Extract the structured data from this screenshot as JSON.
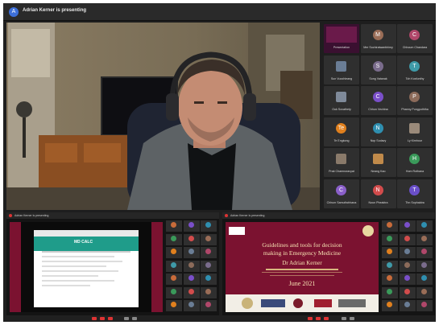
{
  "header": {
    "avatar_letter": "A",
    "presenting_label": "Adrian Kerner is presenting"
  },
  "participants": [
    {
      "kind": "presentation",
      "name": "Presentation",
      "color": "#6a1a4a"
    },
    {
      "kind": "letter",
      "letter": "M",
      "name": "Mer Sochiratwanbhimy",
      "color": "#9a6d57"
    },
    {
      "kind": "letter",
      "letter": "C",
      "name": "Chhoum Chandara",
      "color": "#b0476a"
    },
    {
      "kind": "photo",
      "name": "Sun Vuochleang",
      "color": "#6a7d95"
    },
    {
      "kind": "letter",
      "letter": "S",
      "name": "Song Vatanak",
      "color": "#7a6c8c"
    },
    {
      "kind": "letter",
      "letter": "T",
      "name": "Toh Kosfunthy",
      "color": "#3f9aa8"
    },
    {
      "kind": "photo",
      "name": "Ouk Sovathety",
      "color": "#7f8a9a"
    },
    {
      "kind": "letter",
      "letter": "C",
      "name": "Chhun Vechina",
      "color": "#7a4fc9"
    },
    {
      "kind": "letter",
      "letter": "P",
      "name": "Phanny Pungpuththa",
      "color": "#8c6b5a"
    },
    {
      "kind": "letter",
      "letter": "Te",
      "name": "Te Engkong",
      "color": "#e0801e"
    },
    {
      "kind": "letter",
      "letter": "N",
      "name": "Nop Sodavy",
      "color": "#2f8fb0"
    },
    {
      "kind": "photo",
      "name": "Ly Kimhour",
      "color": "#9a8a7a"
    },
    {
      "kind": "photo",
      "name": "Prak Chamnoravyat",
      "color": "#8a7a6a"
    },
    {
      "kind": "photo",
      "name": "Neang Kao",
      "color": "#c08a4a"
    },
    {
      "kind": "letter",
      "letter": "H",
      "name": "Hom Rothana",
      "color": "#3a9a5a"
    },
    {
      "kind": "letter",
      "letter": "C",
      "name": "Chhum Samuthchhana",
      "color": "#8a5fc9"
    },
    {
      "kind": "letter",
      "letter": "N",
      "name": "Noun Pheaktra",
      "color": "#d24c4c"
    },
    {
      "kind": "letter",
      "letter": "T",
      "name": "Thn Sophaktra",
      "color": "#6a4fc9"
    }
  ],
  "bottom_left": {
    "bar_label": "Adrian Kerner is presenting",
    "browser_title": "MD CALC"
  },
  "bottom_right": {
    "bar_label": "Adrian Kerner is presenting",
    "slide": {
      "line1": "Guidelines and tools for decision",
      "line2": "making in Emergency Medicine",
      "presenter": "Dr Adrian Kerner",
      "date": "June 2021"
    }
  },
  "mini_colors": [
    "#c86b3a",
    "#7a4fc9",
    "#2f8fb0",
    "#3a9a5a",
    "#d24c4c",
    "#9a6d57",
    "#e0801e",
    "#6a7d95",
    "#b0476a",
    "#3f9aa8",
    "#8c6b5a",
    "#7a6c8c"
  ]
}
